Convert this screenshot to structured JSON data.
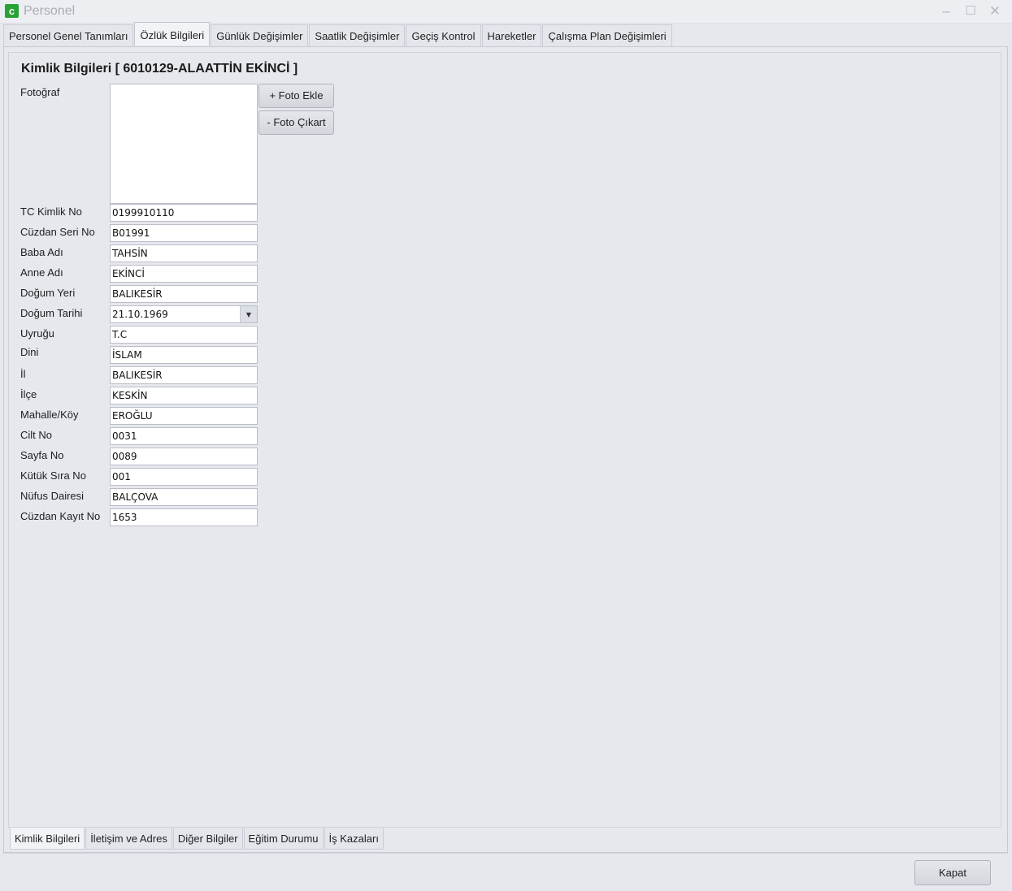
{
  "window": {
    "title": "Personel",
    "logo_letter": "c",
    "controls": {
      "minimize": "–",
      "maximize": "☐",
      "close": "✕"
    }
  },
  "top_tabs": [
    {
      "label": "Personel Genel Tanımları",
      "active": false
    },
    {
      "label": "Özlük Bilgileri",
      "active": true
    },
    {
      "label": "Günlük Değişimler",
      "active": false
    },
    {
      "label": "Saatlik Değişimler",
      "active": false
    },
    {
      "label": "Geçiş Kontrol",
      "active": false
    },
    {
      "label": "Hareketler",
      "active": false
    },
    {
      "label": "Çalışma Plan Değişimleri",
      "active": false
    }
  ],
  "section": {
    "title": "Kimlik Bilgileri [ 6010129-ALAATTİN EKİNCİ ]"
  },
  "photo": {
    "label": "Fotoğraf",
    "add_button": "+ Foto Ekle",
    "remove_button": "- Foto Çıkart"
  },
  "fields": [
    {
      "label": "TC Kimlik No",
      "value": "0199910110"
    },
    {
      "label": "Cüzdan Seri No",
      "value": "B01991"
    },
    {
      "label": "Baba Adı",
      "value": "TAHSİN"
    },
    {
      "label": "Anne Adı",
      "value": "EKİNCİ"
    },
    {
      "label": "Doğum Yeri",
      "value": "BALIKESİR"
    },
    {
      "label": "Doğum Tarihi",
      "value": "21.10.1969",
      "type": "date-dropdown"
    },
    {
      "label": "Uyruğu",
      "value": "T.C"
    },
    {
      "label": "Dini",
      "value": "İSLAM"
    },
    {
      "label": "İl",
      "value": "BALIKESİR"
    },
    {
      "label": "İlçe",
      "value": "KESKİN"
    },
    {
      "label": "Mahalle/Köy",
      "value": "EROĞLU"
    },
    {
      "label": "Cilt No",
      "value": "0031"
    },
    {
      "label": "Sayfa No",
      "value": "0089"
    },
    {
      "label": "Kütük Sıra No",
      "value": "001"
    },
    {
      "label": "Nüfus Dairesi",
      "value": "BALÇOVA"
    },
    {
      "label": "Cüzdan Kayıt No",
      "value": "1653"
    }
  ],
  "bottom_tabs": [
    {
      "label": "Kimlik Bilgileri",
      "active": true
    },
    {
      "label": "İletişim ve Adres",
      "active": false
    },
    {
      "label": "Diğer Bilgiler",
      "active": false
    },
    {
      "label": "Eğitim Durumu",
      "active": false
    },
    {
      "label": "İş Kazaları",
      "active": false
    }
  ],
  "footer": {
    "close_button": "Kapat"
  },
  "colors": {
    "logo_green": "#27a334",
    "background": "#e6e8ee"
  }
}
